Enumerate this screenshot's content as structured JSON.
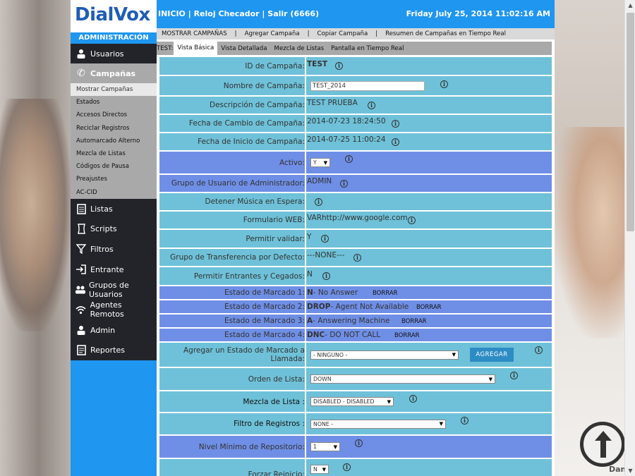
{
  "brand": {
    "logo": "DialVox",
    "sub": "ADMINISTRACIÓN"
  },
  "topbar": {
    "left": "INICIO  |  Reloj Checador  |  Salir  (6666)",
    "date": "Friday July 25, 2014 11:02:16 AM"
  },
  "sidebar": {
    "usuarios": "Usuarios",
    "campanas": "Campañas",
    "subitems": [
      "Mostrar Campañas",
      "Estados",
      "Accesos Directos",
      "Reciclar Registros",
      "Automarcado Alterno",
      "Mezcla de Listas",
      "Códigos de Pausa",
      "Preajustes",
      "AC-CID"
    ],
    "items": [
      "Listas",
      "Scripts",
      "Filtros",
      "Entrante",
      "Grupos de Usuarios",
      "Agentes Remotos",
      "Admin",
      "Reportes"
    ]
  },
  "menu": [
    "MOSTRAR CAMPAÑAS",
    "Agregar Campaña",
    "Copiar Campaña",
    "Resumen de Campañas en Tiempo Real"
  ],
  "tabs": {
    "prefix": "TEST:",
    "items": [
      "Vista Básica",
      "Vista Detallada",
      "Mezcla de Listas",
      "Pantalla en Tiempo Real"
    ]
  },
  "form": {
    "id_label": "ID de Campaña:",
    "id_value": "TEST",
    "nombre_label": "Nombre de Campaña:",
    "nombre_value": "TEST_2014",
    "desc_label": "Descripción de Campaña:",
    "desc_value": "TEST PRUEBA",
    "cambio_label": "Fecha de Cambio de Campaña:",
    "cambio_value": "2014-07-23 18:24:50",
    "inicio_label": "Fecha de Inicio de Campaña:",
    "inicio_value": "2014-07-25 11:00:24",
    "activo_label": "Activo:",
    "activo_value": "Y",
    "grupo_admin_label": "Grupo de Usuario de Administrador:",
    "grupo_admin_value": "ADMIN",
    "musica_label": "Detener Música en Espera:",
    "web_label": "Formulario WEB:",
    "web_value": "VARhttp://www.google.com",
    "validar_label": "Permitir validar:",
    "validar_value": "Y",
    "transfer_label": "Grupo de Transferencia por Defecto:",
    "transfer_value": "---NONE---",
    "entrantes_label": "Permitir Entrantes y Cegados:",
    "entrantes_value": "N",
    "estados": [
      {
        "label": "Estado de Marcado 1:",
        "code": "N",
        "desc": " - No Answer",
        "action": "BORRAR"
      },
      {
        "label": "Estado de Marcado 2:",
        "code": "DROP",
        "desc": " - Agent Not Available",
        "action": "BORRAR"
      },
      {
        "label": "Estado de Marcado 3:",
        "code": "A",
        "desc": " - Answering Machine",
        "action": "BORRAR"
      },
      {
        "label": "Estado de Marcado 4:",
        "code": "DNC",
        "desc": " - DO NOT CALL",
        "action": "BORRAR"
      }
    ],
    "agregar_estado_label": "Agregar un Estado de Marcado a Llamada:",
    "agregar_estado_value": "- NINGUNO -",
    "agregar_btn": "AGREGAR",
    "orden_label": "Orden de Lista:",
    "orden_value": "DOWN",
    "mezcla_label": "Mezcla de Lista :",
    "mezcla_value": "DISABLED - DISABLED",
    "filtro_label": "Filtro de Registros :",
    "filtro_value": "NONE -",
    "nivel_label": "Nivel Mínimo de Repositorio:",
    "nivel_value": "1",
    "forzar_label": "Forzar Reinicio:",
    "forzar_value": "N"
  },
  "corner_text": "Dan"
}
